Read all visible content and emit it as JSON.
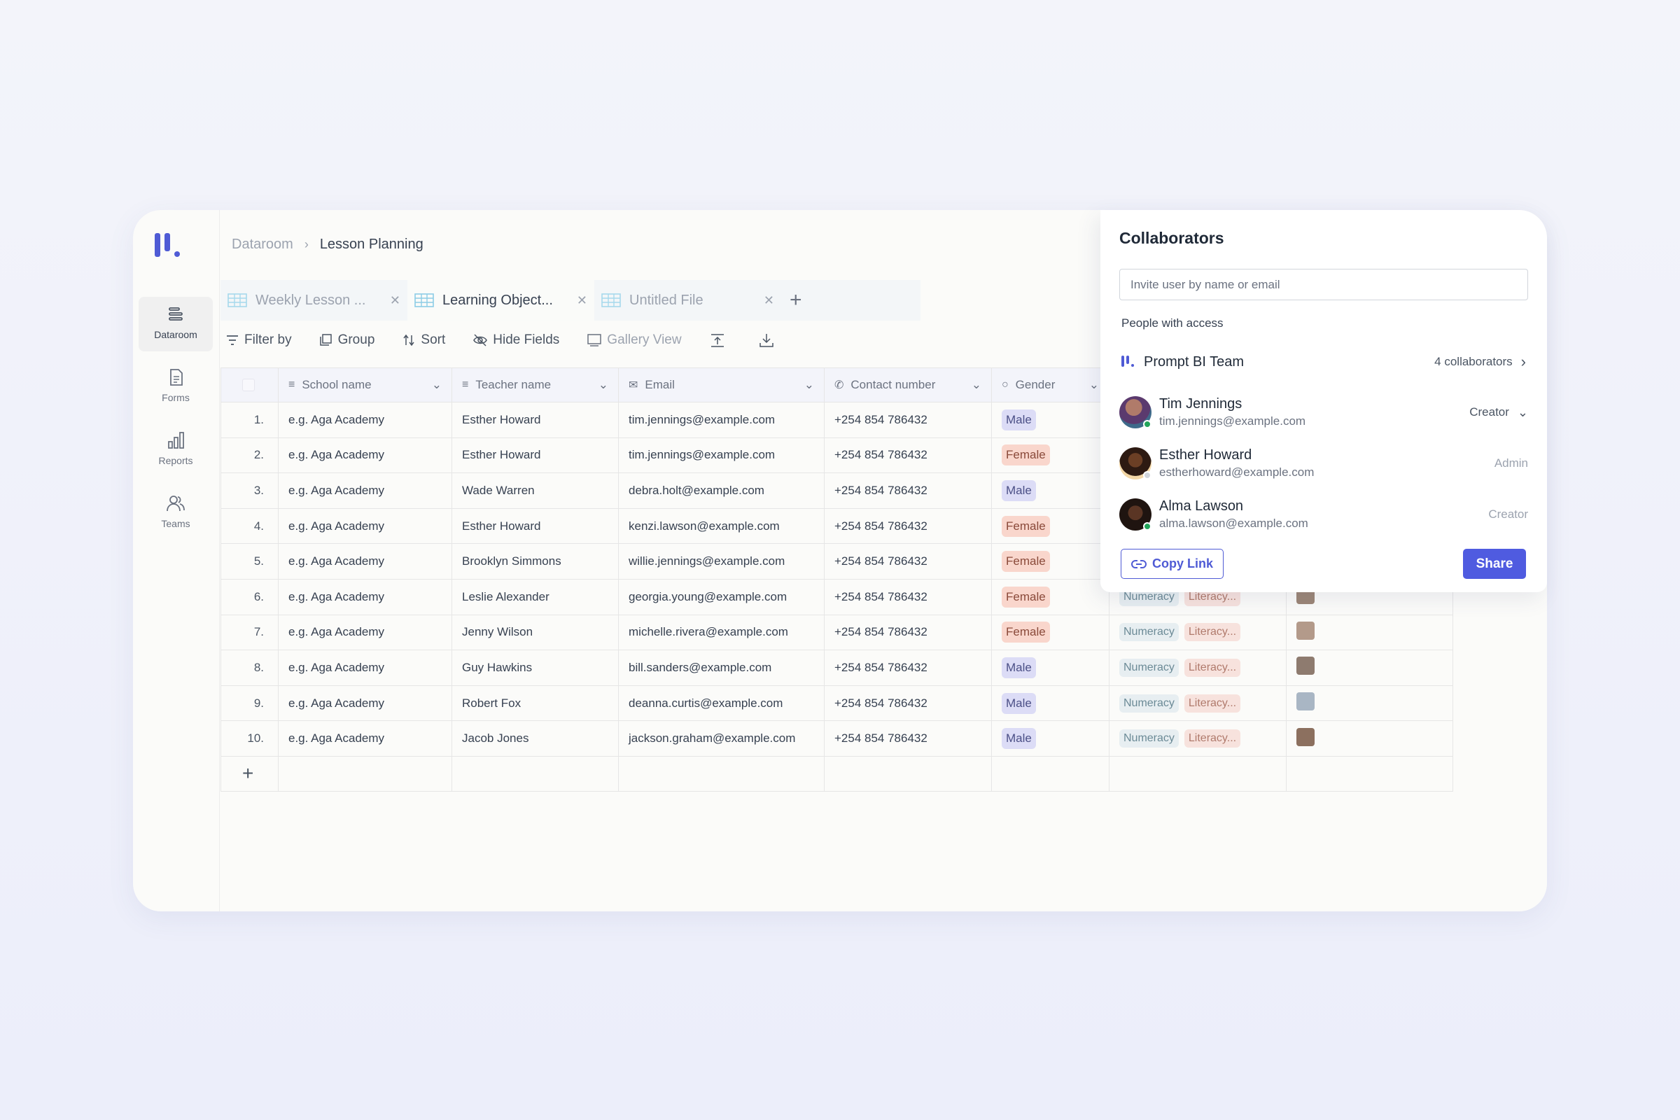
{
  "sidebar": {
    "items": [
      {
        "label": "Dataroom",
        "icon": "dataroom-icon",
        "active": true
      },
      {
        "label": "Forms",
        "icon": "form-icon"
      },
      {
        "label": "Reports",
        "icon": "bar-chart-icon"
      },
      {
        "label": "Teams",
        "icon": "team-icon"
      }
    ]
  },
  "breadcrumb": {
    "root": "Dataroom",
    "current": "Lesson Planning"
  },
  "tabs": [
    {
      "label": "Weekly Lesson ...",
      "active": false
    },
    {
      "label": "Learning Object...",
      "active": true
    },
    {
      "label": "Untitled File",
      "active": false
    }
  ],
  "toolbar": {
    "filter": "Filter by",
    "group": "Group",
    "sort": "Sort",
    "hide": "Hide Fields",
    "gallery": "Gallery View"
  },
  "table": {
    "columns": [
      "School name",
      "Teacher name",
      "Email",
      "Contact number",
      "Gender"
    ],
    "rows": [
      {
        "n": "1.",
        "school": "e.g. Aga Academy",
        "teacher": "Esther Howard",
        "email": "tim.jennings@example.com",
        "phone": "+254 854 786432",
        "gender": "Male"
      },
      {
        "n": "2.",
        "school": "e.g. Aga Academy",
        "teacher": "Esther Howard",
        "email": "tim.jennings@example.com",
        "phone": "+254 854 786432",
        "gender": "Female"
      },
      {
        "n": "3.",
        "school": "e.g. Aga Academy",
        "teacher": "Wade Warren",
        "email": "debra.holt@example.com",
        "phone": "+254 854 786432",
        "gender": "Male"
      },
      {
        "n": "4.",
        "school": "e.g. Aga Academy",
        "teacher": "Esther Howard",
        "email": "kenzi.lawson@example.com",
        "phone": "+254 854 786432",
        "gender": "Female"
      },
      {
        "n": "5.",
        "school": "e.g. Aga Academy",
        "teacher": "Brooklyn Simmons",
        "email": "willie.jennings@example.com",
        "phone": "+254 854 786432",
        "gender": "Female"
      },
      {
        "n": "6.",
        "school": "e.g. Aga Academy",
        "teacher": "Leslie Alexander",
        "email": "georgia.young@example.com",
        "phone": "+254 854 786432",
        "gender": "Female",
        "tags": [
          "Numeracy",
          "Literacy..."
        ]
      },
      {
        "n": "7.",
        "school": "e.g. Aga Academy",
        "teacher": "Jenny Wilson",
        "email": "michelle.rivera@example.com",
        "phone": "+254 854 786432",
        "gender": "Female",
        "tags": [
          "Numeracy",
          "Literacy..."
        ]
      },
      {
        "n": "8.",
        "school": "e.g. Aga Academy",
        "teacher": "Guy Hawkins",
        "email": "bill.sanders@example.com",
        "phone": "+254 854 786432",
        "gender": "Male",
        "tags": [
          "Numeracy",
          "Literacy..."
        ]
      },
      {
        "n": "9.",
        "school": "e.g. Aga Academy",
        "teacher": "Robert Fox",
        "email": "deanna.curtis@example.com",
        "phone": "+254 854 786432",
        "gender": "Male",
        "tags": [
          "Numeracy",
          "Literacy..."
        ]
      },
      {
        "n": "10.",
        "school": "e.g. Aga Academy",
        "teacher": "Jacob Jones",
        "email": "jackson.graham@example.com",
        "phone": "+254 854 786432",
        "gender": "Male",
        "tags": [
          "Numeracy",
          "Literacy..."
        ]
      }
    ]
  },
  "collaborators": {
    "title": "Collaborators",
    "invite_placeholder": "Invite user by name or email",
    "people_label": "People with access",
    "team": {
      "name": "Prompt BI Team",
      "count": "4 collaborators"
    },
    "people": [
      {
        "name": "Tim Jennings",
        "email": "tim.jennings@example.com",
        "role": "Creator"
      },
      {
        "name": "Esther Howard",
        "email": "estherhoward@example.com",
        "role": "Admin"
      },
      {
        "name": "Alma Lawson",
        "email": "alma.lawson@example.com",
        "role": "Creator"
      }
    ],
    "copy_link": "Copy Link",
    "share": "Share"
  },
  "colors": {
    "accent": "#4f5bd5",
    "male_chip": "#dcdcf6",
    "female_chip": "#f9d6cc"
  }
}
